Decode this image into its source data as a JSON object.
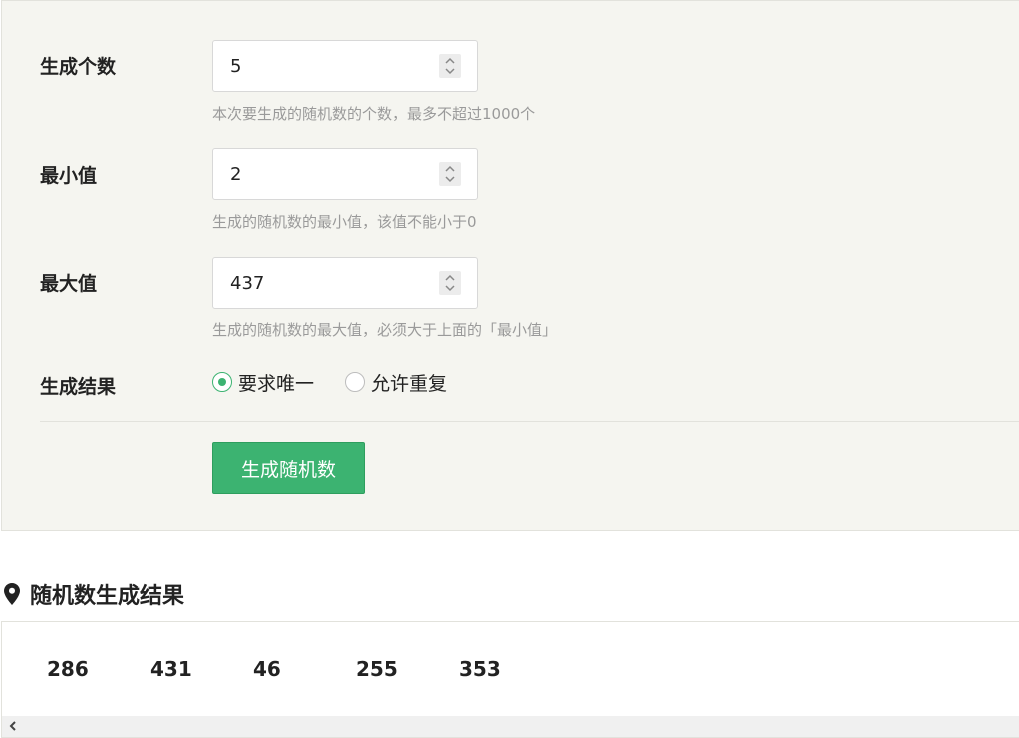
{
  "form": {
    "count": {
      "label": "生成个数",
      "value": "5",
      "hint": "本次要生成的随机数的个数，最多不超过1000个"
    },
    "min": {
      "label": "最小值",
      "value": "2",
      "hint": "生成的随机数的最小值，该值不能小于0"
    },
    "max": {
      "label": "最大值",
      "value": "437",
      "hint": "生成的随机数的最大值，必须大于上面的「最小值」"
    },
    "result_mode": {
      "label": "生成结果",
      "options": [
        {
          "label": "要求唯一",
          "checked": true
        },
        {
          "label": "允许重复",
          "checked": false
        }
      ]
    },
    "submit_label": "生成随机数"
  },
  "result": {
    "title": "随机数生成结果",
    "numbers": [
      "286",
      "431",
      "46",
      "255",
      "353"
    ]
  },
  "colors": {
    "accent": "#3cb371",
    "panel_bg": "#f5f5f0",
    "hint_text": "#9a9a9a"
  }
}
